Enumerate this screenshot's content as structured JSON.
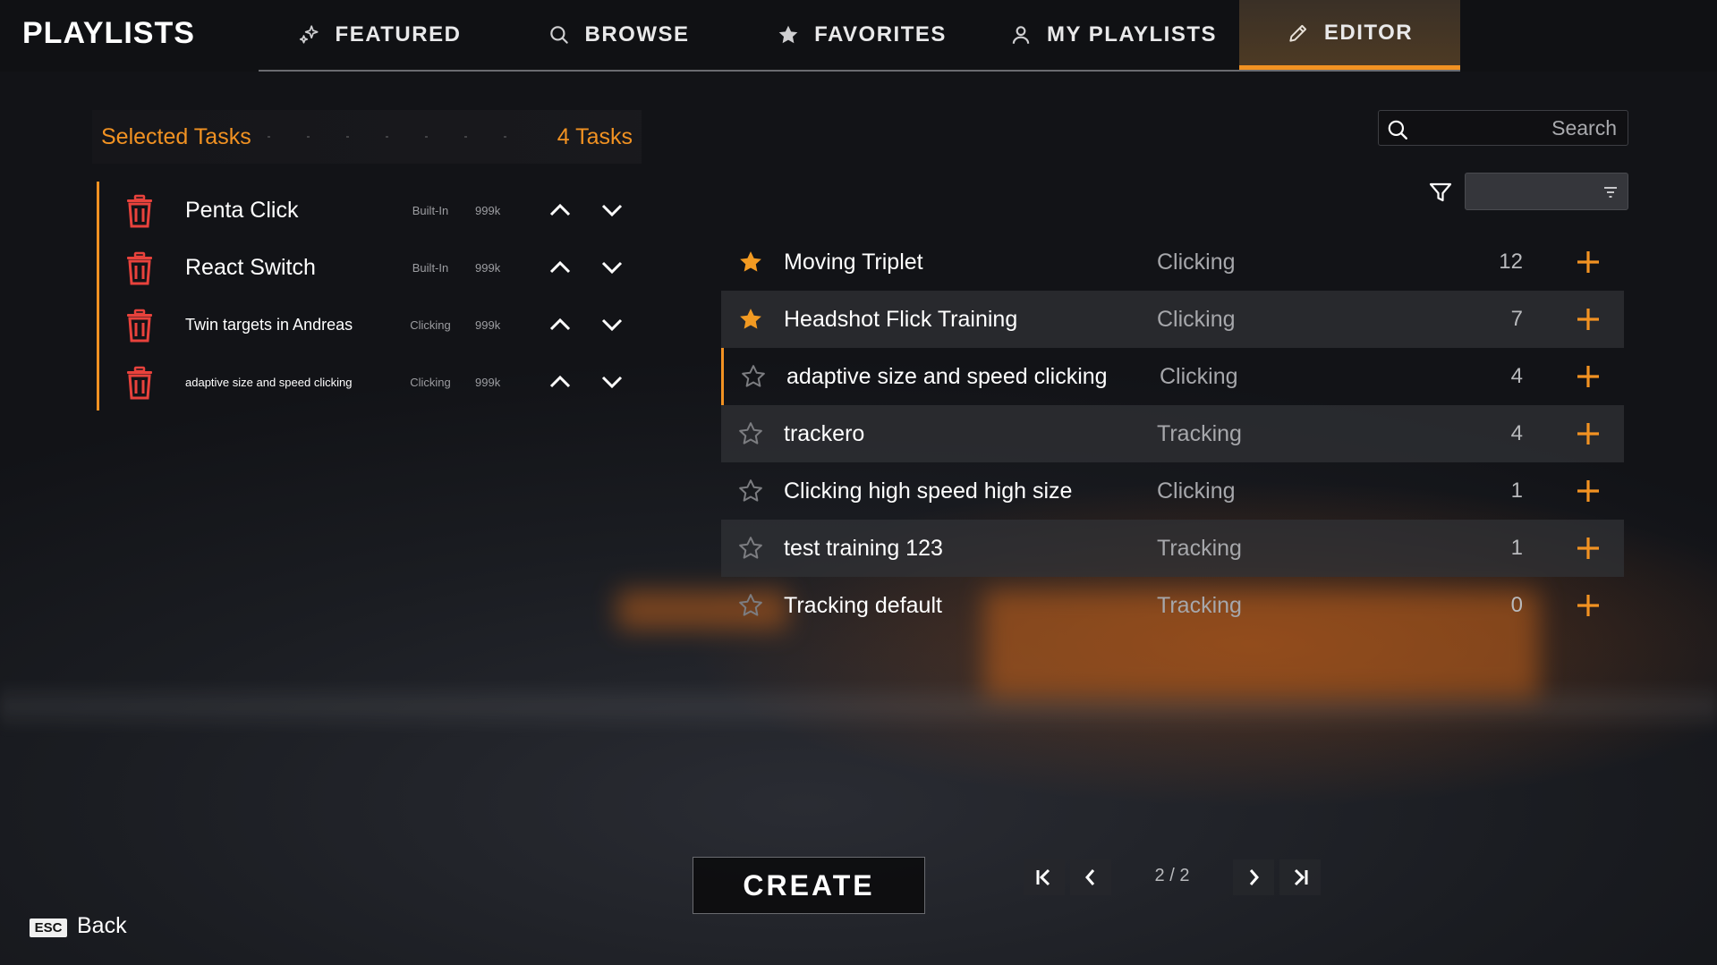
{
  "app": {
    "title": "PLAYLISTS"
  },
  "tabs": [
    {
      "label": "FEATURED",
      "icon": "sparkle-icon",
      "active": false
    },
    {
      "label": "BROWSE",
      "icon": "search-icon",
      "active": false
    },
    {
      "label": "FAVORITES",
      "icon": "star-icon",
      "active": false
    },
    {
      "label": "MY PLAYLISTS",
      "icon": "user-icon",
      "active": false
    },
    {
      "label": "EDITOR",
      "icon": "pencil-icon",
      "active": true
    }
  ],
  "selected": {
    "title": "Selected Tasks",
    "count": "4 Tasks",
    "tasks": [
      {
        "name": "Penta Click",
        "type": "Built-In",
        "plays": "999k"
      },
      {
        "name": "React Switch",
        "type": "Built-In",
        "plays": "999k"
      },
      {
        "name": "Twin targets in Andreas",
        "type": "Clicking",
        "plays": "999k"
      },
      {
        "name": "adaptive size and speed clicking",
        "type": "Clicking",
        "plays": "999k"
      }
    ]
  },
  "search": {
    "placeholder": "Search",
    "value": ""
  },
  "sort": {
    "value": ""
  },
  "browse": {
    "items": [
      {
        "name": "Moving Triplet",
        "category": "Clicking",
        "count": "12",
        "favorite": true
      },
      {
        "name": "Headshot Flick Training",
        "category": "Clicking",
        "count": "7",
        "favorite": true
      },
      {
        "name": "adaptive size and speed clicking",
        "category": "Clicking",
        "count": "4",
        "favorite": false
      },
      {
        "name": "trackero",
        "category": "Tracking",
        "count": "4",
        "favorite": false
      },
      {
        "name": "Clicking high speed high size",
        "category": "Clicking",
        "count": "1",
        "favorite": false
      },
      {
        "name": "test training 123",
        "category": "Tracking",
        "count": "1",
        "favorite": false
      },
      {
        "name": "Tracking default",
        "category": "Tracking",
        "count": "0",
        "favorite": false
      }
    ]
  },
  "actions": {
    "create": "CREATE"
  },
  "pagination": {
    "label": "2 / 2"
  },
  "footer": {
    "key": "ESC",
    "back": "Back"
  },
  "colors": {
    "accent": "#f29222",
    "trash": "#e8423c",
    "star_filled": "#f29a22",
    "star_empty": "#7c7d81"
  }
}
